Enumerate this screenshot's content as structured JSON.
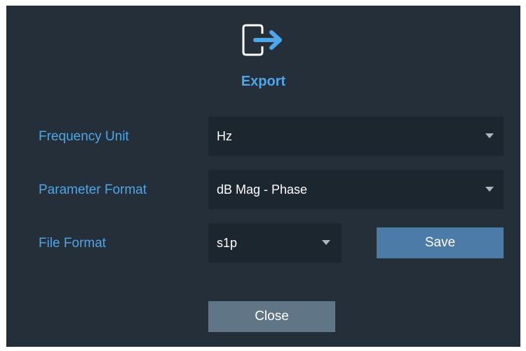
{
  "dialog": {
    "title": "Export",
    "icon": "export-icon",
    "colors": {
      "background": "#242f3a",
      "accent": "#4da6e8",
      "field_background": "#1c262f",
      "save_button": "#4c7ba8",
      "close_button": "#607686"
    }
  },
  "fields": {
    "frequency_unit": {
      "label": "Frequency Unit",
      "value": "Hz"
    },
    "parameter_format": {
      "label": "Parameter Format",
      "value": "dB Mag - Phase"
    },
    "file_format": {
      "label": "File Format",
      "value": "s1p"
    }
  },
  "buttons": {
    "save": "Save",
    "close": "Close"
  }
}
